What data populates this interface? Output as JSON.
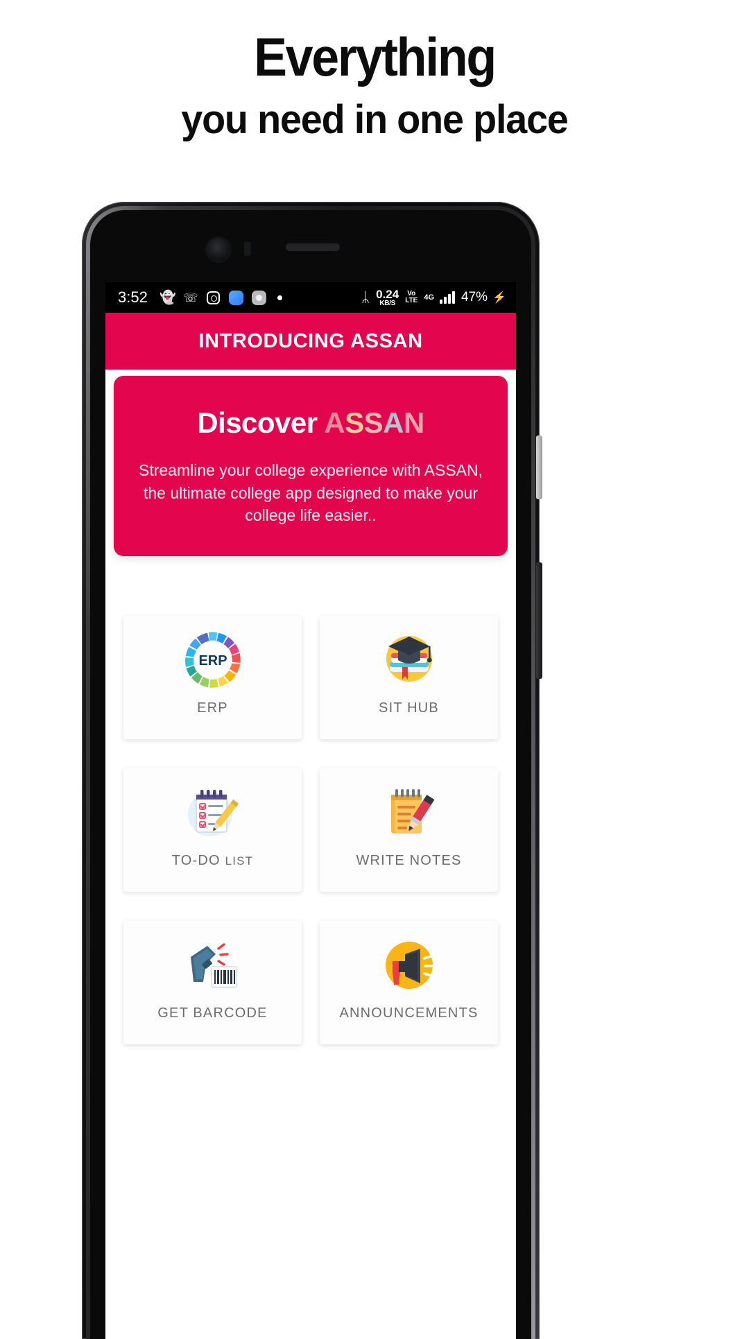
{
  "promo": {
    "headline_line1": "Everything",
    "headline_line2": "you need in one place"
  },
  "phone": {
    "statusbar": {
      "time": "3:52",
      "left_icons": [
        "snapchat-icon",
        "missed-call-icon",
        "instagram-icon",
        "blue-app-icon",
        "gray-app-icon",
        "more-notifications-dot"
      ],
      "bluetooth": "ᛦ",
      "net_speed_value": "0.24",
      "net_speed_unit": "KB/S",
      "volte_line1": "Vo",
      "volte_line2": "LTE",
      "network_type": "4G",
      "battery": "47%",
      "charging_bolt": "⚡"
    },
    "appbar": {
      "title": "INTRODUCING ASSAN"
    },
    "hero": {
      "title_plain": "Discover ",
      "brand_letters": [
        {
          "char": "A",
          "color": "#f2899b"
        },
        {
          "char": "S",
          "color": "#f9cd9a"
        },
        {
          "char": "S",
          "color": "#f7b6ae"
        },
        {
          "char": "A",
          "color": "#b9c3cf"
        },
        {
          "char": "N",
          "color": "#f4a0ad"
        }
      ],
      "description": "Streamline your college experience with ASSAN, the ultimate college app designed to make your college life easier.."
    },
    "grid": {
      "tiles": [
        {
          "label": "ERP",
          "icon": "erp-icon"
        },
        {
          "label": "SIT HUB",
          "icon": "sit-hub-icon"
        },
        {
          "label": "TO-DO LIST",
          "icon": "todo-list-icon"
        },
        {
          "label": "WRITE NOTES",
          "icon": "write-notes-icon"
        },
        {
          "label": "GET BARCODE",
          "icon": "barcode-scanner-icon"
        },
        {
          "label": "ANNOUNCEMENTS",
          "icon": "announcements-icon"
        }
      ]
    }
  },
  "colors": {
    "brand_pink": "#e4054f",
    "page_background": "#ffffff",
    "headline_text": "#0c0c0c",
    "tile_label": "#6c6c6c"
  }
}
